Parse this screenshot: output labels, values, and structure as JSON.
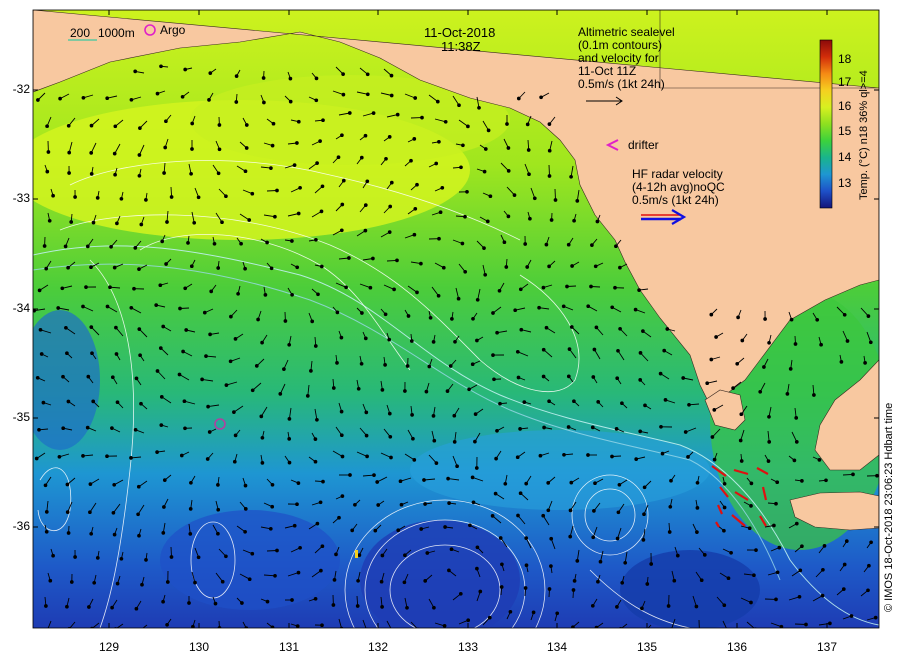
{
  "header": {
    "date": "11-Oct-2018",
    "time": "11:38Z"
  },
  "legend": {
    "contour_200": "200",
    "contour_1000": "1000m",
    "argo_label": "Argo",
    "altimetric_lines": [
      "Altimetric sealevel",
      "(0.1m contours)",
      "and velocity for",
      "11-Oct 11Z",
      "0.5m/s (1kt 24h)"
    ],
    "drifter_label": "drifter",
    "hf_lines": [
      "HF radar velocity",
      "(4-12h avg)noQC",
      "0.5m/s (1kt 24h)"
    ]
  },
  "colorbar": {
    "title": "Temp. (°C) n18 36% ql>=4",
    "ticks": [
      "18",
      "17",
      "16",
      "15",
      "14",
      "13"
    ],
    "colors": [
      "#8b0a0a",
      "#d22d0a",
      "#f58a14",
      "#f5d020",
      "#d8f020",
      "#8ee020",
      "#3cd23c",
      "#19b48c",
      "#1e96d2",
      "#1e50c8",
      "#14147a"
    ]
  },
  "axes": {
    "y_ticks": [
      "-32",
      "-33",
      "-34",
      "-35",
      "-36"
    ],
    "x_ticks": [
      "129",
      "130",
      "131",
      "132",
      "133",
      "134",
      "135",
      "136",
      "137"
    ]
  },
  "credit": "© IMOS 18-Oct-2018 23:06:23 Hdbart time",
  "colors": {
    "land": "#f8c8a0",
    "warm_water": "#c8f020",
    "mid_water": "#3cc83c",
    "cool_water": "#1e96d2",
    "deep_cool": "#1e3cb4",
    "argo_marker": "#e020c8",
    "drifter_marker": "#e020c8",
    "hf_arrow": "#1010e0"
  }
}
